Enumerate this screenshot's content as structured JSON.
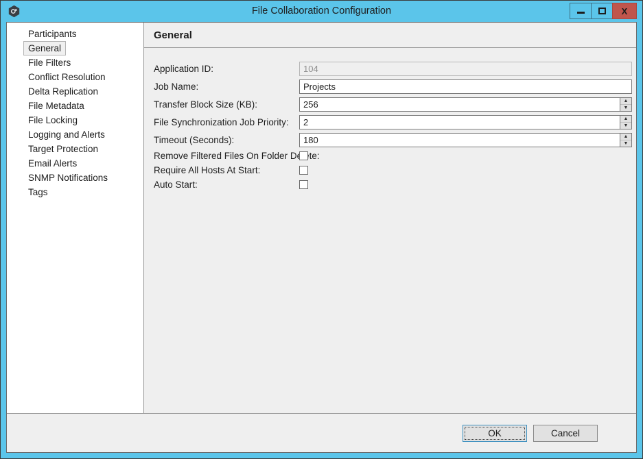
{
  "window": {
    "title": "File Collaboration Configuration",
    "app_icon": "app-hexagon-icon",
    "controls": {
      "minimize": "minimize-icon",
      "maximize": "maximize-icon",
      "close_label": "X"
    }
  },
  "sidebar": {
    "items": [
      {
        "label": "Participants",
        "selected": false
      },
      {
        "label": "General",
        "selected": true
      },
      {
        "label": "File Filters",
        "selected": false
      },
      {
        "label": "Conflict Resolution",
        "selected": false
      },
      {
        "label": "Delta Replication",
        "selected": false
      },
      {
        "label": "File Metadata",
        "selected": false
      },
      {
        "label": "File Locking",
        "selected": false
      },
      {
        "label": "Logging and Alerts",
        "selected": false
      },
      {
        "label": "Target Protection",
        "selected": false
      },
      {
        "label": "Email Alerts",
        "selected": false
      },
      {
        "label": "SNMP Notifications",
        "selected": false
      },
      {
        "label": "Tags",
        "selected": false
      }
    ]
  },
  "main": {
    "panel_title": "General",
    "fields": [
      {
        "label": "Application ID:",
        "value": "104",
        "disabled": true,
        "spinner": false
      },
      {
        "label": "Job Name:",
        "value": "Projects",
        "disabled": false,
        "spinner": false
      },
      {
        "label": "Transfer Block Size (KB):",
        "value": "256",
        "disabled": false,
        "spinner": true
      },
      {
        "label": "File Synchronization Job Priority:",
        "value": "2",
        "disabled": false,
        "spinner": true
      },
      {
        "label": "Timeout (Seconds):",
        "value": "180",
        "disabled": false,
        "spinner": true
      }
    ],
    "checkboxes": [
      {
        "label": "Remove Filtered Files On Folder Delete:",
        "checked": false
      },
      {
        "label": "Require All Hosts At Start:",
        "checked": false
      },
      {
        "label": "Auto Start:",
        "checked": false
      }
    ],
    "spinner_up_glyph": "▲",
    "spinner_down_glyph": "▼"
  },
  "footer": {
    "ok_label": "OK",
    "cancel_label": "Cancel"
  },
  "colors": {
    "titlebar": "#5BC5EA",
    "close_button": "#C0554C",
    "panel_background": "#EFEFEF",
    "sidebar_background": "#FFFFFF",
    "focus_border": "#3C8FBF"
  }
}
